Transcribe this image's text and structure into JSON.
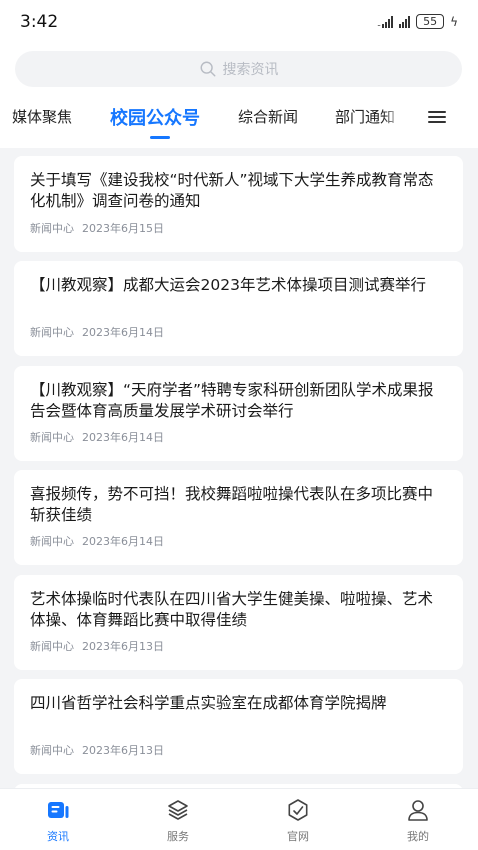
{
  "status_bar": {
    "time": "3:42",
    "battery": "55"
  },
  "search": {
    "placeholder": "搜索资讯"
  },
  "tabs": [
    {
      "label": "媒体聚焦",
      "active": false
    },
    {
      "label": "校园公众号",
      "active": true
    },
    {
      "label": "综合新闻",
      "active": false
    },
    {
      "label": "部门通知",
      "active": false
    }
  ],
  "articles": [
    {
      "title": "关于填写《建设我校“时代新人”视域下大学生养成教育常态化机制》调查问卷的通知",
      "source": "新闻中心",
      "date": "2023年6月15日"
    },
    {
      "title": "【川教观察】成都大运会2023年艺术体操项目测试赛举行",
      "source": "新闻中心",
      "date": "2023年6月14日"
    },
    {
      "title": "【川教观察】“天府学者”特聘专家科研创新团队学术成果报告会暨体育高质量发展学术研讨会举行",
      "source": "新闻中心",
      "date": "2023年6月14日"
    },
    {
      "title": "喜报频传，势不可挡！我校舞蹈啦啦操代表队在多项比赛中斩获佳绩",
      "source": "新闻中心",
      "date": "2023年6月14日"
    },
    {
      "title": "艺术体操临时代表队在四川省大学生健美操、啦啦操、艺术体操、体育舞蹈比赛中取得佳绩",
      "source": "新闻中心",
      "date": "2023年6月13日"
    },
    {
      "title": "四川省哲学社会科学重点实验室在成都体育学院揭牌",
      "source": "新闻中心",
      "date": "2023年6月13日"
    }
  ],
  "bottom_nav": [
    {
      "label": "资讯",
      "icon": "news-icon",
      "active": true
    },
    {
      "label": "服务",
      "icon": "layers-icon",
      "active": false
    },
    {
      "label": "官网",
      "icon": "compass-icon",
      "active": false
    },
    {
      "label": "我的",
      "icon": "user-icon",
      "active": false
    }
  ],
  "colors": {
    "accent": "#1677ff",
    "background": "#f3f4f6",
    "card": "#ffffff",
    "meta_text": "#8a8f99"
  }
}
